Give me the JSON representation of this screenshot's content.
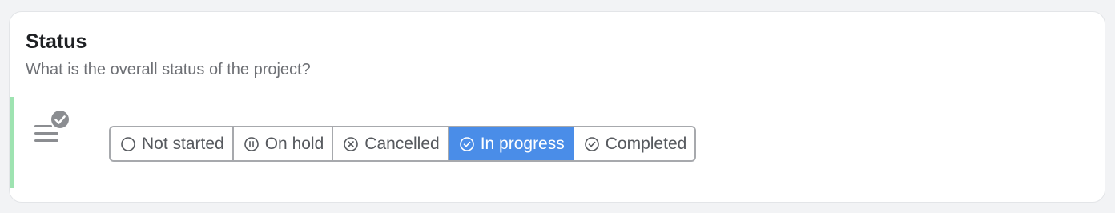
{
  "card": {
    "title": "Status",
    "question": "What is the overall status of the project?"
  },
  "field_icon": "list-with-check-icon",
  "status_options": [
    {
      "label": "Not started",
      "icon": "empty-circle-icon",
      "selected": false
    },
    {
      "label": "On hold",
      "icon": "pause-circle-icon",
      "selected": false
    },
    {
      "label": "Cancelled",
      "icon": "x-circle-icon",
      "selected": false
    },
    {
      "label": "In progress",
      "icon": "check-circle-icon",
      "selected": true
    },
    {
      "label": "Completed",
      "icon": "check-circle-icon",
      "selected": false
    }
  ],
  "colors": {
    "accent_bar": "#9ee3b1",
    "selected_background": "#4a8de8",
    "selected_text": "#ffffff",
    "option_text": "#56595e"
  }
}
